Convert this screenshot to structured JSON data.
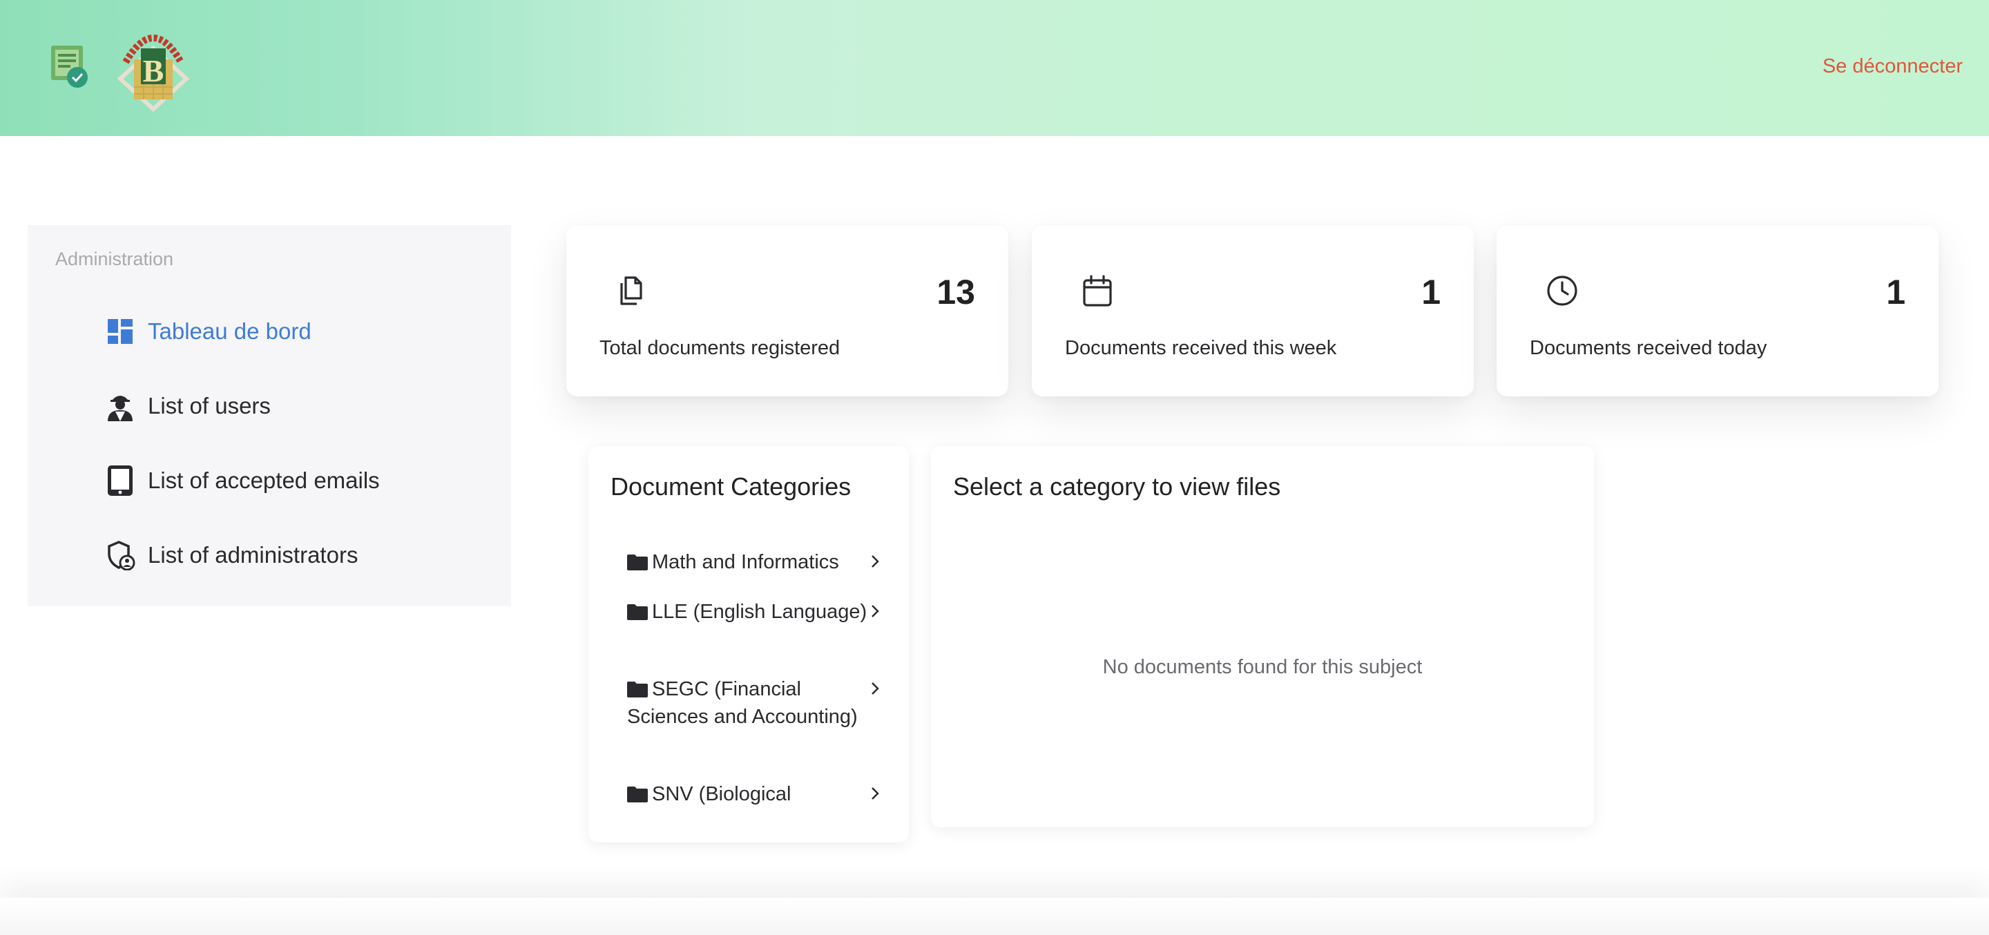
{
  "header": {
    "logout_label": "Se déconnecter",
    "app_logo_icon": "document-check-icon",
    "university_logo_icon": "university-crest-logo"
  },
  "sidebar": {
    "section_title": "Administration",
    "items": [
      {
        "label": "Tableau de bord",
        "icon": "dashboard-icon",
        "active": true
      },
      {
        "label": "List of users",
        "icon": "user-worker-icon",
        "active": false
      },
      {
        "label": "List of accepted emails",
        "icon": "tablet-icon",
        "active": false
      },
      {
        "label": "List of administrators",
        "icon": "shield-user-icon",
        "active": false
      }
    ]
  },
  "stats": [
    {
      "value": "13",
      "label": "Total documents registered",
      "icon": "copy-documents-icon"
    },
    {
      "value": "1",
      "label": "Documents received this week",
      "icon": "calendar-icon"
    },
    {
      "value": "1",
      "label": "Documents received today",
      "icon": "clock-icon"
    }
  ],
  "categories": {
    "title": "Document Categories",
    "items": [
      {
        "label": "Math and Informatics"
      },
      {
        "label": "LLE (English Language)"
      },
      {
        "label": "SEGC (Financial Sciences and Accounting)"
      },
      {
        "label": "SNV (Biological"
      }
    ]
  },
  "files": {
    "title": "Select a category to view files",
    "empty_message": "No documents found for this subject"
  },
  "colors": {
    "accent_blue": "#3e7bd6",
    "logout_red": "#e0563b",
    "header_green": "#c6f3d4"
  }
}
